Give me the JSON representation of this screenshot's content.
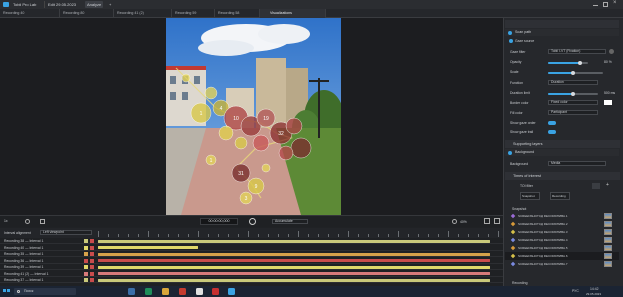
{
  "titlebar": {
    "app_name": "Tobii Pro Lab",
    "tab_edit": "Edit 29.05.2023",
    "tab_analyze": "Analyze",
    "tab_add": "+"
  },
  "recording_tabs": [
    {
      "label": "Recording 40"
    },
    {
      "label": "Recording 80"
    },
    {
      "label": "Recording 41 (2)"
    },
    {
      "label": "Recording 59"
    },
    {
      "label": "Recording 58"
    },
    {
      "label": "Visualizations"
    }
  ],
  "right_panel": {
    "scan_path": "Scan path",
    "gaze_source": "Gaze source",
    "gaze_filter_label": "Gaze filter",
    "gaze_filter_value": "Tobii I-VT (Fixation)",
    "opacity_label": "Opacity",
    "opacity_value": "80 %",
    "opacity": 0.8,
    "scale_label": "Scale",
    "scale": 0.45,
    "function_label": "Function",
    "function_value": "Duration",
    "duration_limit_label": "Duration limit",
    "duration_limit_value": "500 ms",
    "duration_limit": 0.5,
    "border_color_label": "Border color",
    "border_color_value": "Fixed color",
    "fill_color_label": "Fill color",
    "fill_color_value": "Participant",
    "show_gaze_order_label": "Show gaze order",
    "show_gaze_trail_label": "Show gaze trail",
    "supporting_layers": "Supporting layers",
    "background": "Background",
    "background_label": "Background",
    "background_value": "Media",
    "times_of_interest": "Times of interest",
    "toi_filter": "TOI filter",
    "snapshot_label": "Snapshot",
    "recording_label": "Recording",
    "snapshot_items": [
      "SCREENSHOTСД RECORDПИВА.1",
      "SCREENSHOTСД RECORDПИВА.2",
      "SCREENSHOTСД RECORDПИВА.3",
      "SCREENSHOTСД RECORDПИВА.4",
      "SCREENSHOTСД RECORDПИВА.5",
      "SCREENSHOTСД RECORDПИВА.6",
      "SCREENSHOTСД RECORDПИВА.7"
    ],
    "snapshot_header": "Snapshot",
    "recording_footer": "Recording"
  },
  "controls": {
    "speed": "1x",
    "timecode": "00:00:00,000",
    "accumulate": "Accumulate",
    "zoom": "40%"
  },
  "timeline": {
    "interval_alignment_label": "Interval alignment",
    "interval_alignment_value": "Left viewpoint",
    "rows": [
      {
        "name": "Recording 38 — Interval 1",
        "color": "#c9c97a",
        "bar_end": 0.98
      },
      {
        "name": "Recording 40 — Interval 1",
        "color": "#e0d86a",
        "bar_end": 0.25
      },
      {
        "name": "Recording 35 — Interval 1",
        "color": "#d6a24a",
        "bar_end": 0.98
      },
      {
        "name": "Recording 36 — Interval 1",
        "color": "#c94c4c",
        "bar_end": 0.98
      },
      {
        "name": "Recording 39 — Interval 1",
        "color": "#e0d86a",
        "bar_end": 0.98
      },
      {
        "name": "Recording 41 (2) — Interval 1",
        "color": "#d67a7a",
        "bar_end": 0.98
      },
      {
        "name": "Recording 37 — Interval 1",
        "color": "#c9c97a",
        "bar_end": 0.98
      }
    ]
  },
  "taskbar": {
    "search_placeholder": "Поиск",
    "language": "РУС",
    "time": "14:42",
    "date": "29.05.2023"
  },
  "fixations": [
    {
      "n": "1"
    },
    {
      "n": "4"
    },
    {
      "n": "10"
    },
    {
      "n": "19"
    },
    {
      "n": "32"
    },
    {
      "n": "31"
    },
    {
      "n": "9"
    },
    {
      "n": "1"
    },
    {
      "n": "3"
    }
  ]
}
